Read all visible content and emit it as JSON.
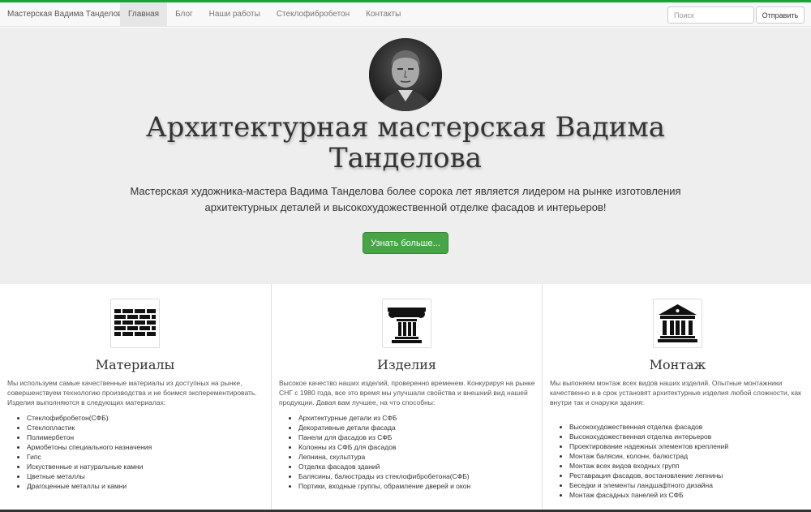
{
  "header": {
    "brand": "Мастерская Вадима Танделова",
    "nav": [
      {
        "label": "Главная"
      },
      {
        "label": "Блог"
      },
      {
        "label": "Наши работы"
      },
      {
        "label": "Стеклофибробетон"
      },
      {
        "label": "Контакты"
      }
    ],
    "search_placeholder": "Поиск",
    "send_label": "Отправить"
  },
  "hero": {
    "title": "Архитектурная мастерская Вадима Танделова",
    "text": "Мастерская художника-мастера Вадима Танделова более сорока лет является лидером на рынке изготовления архитектурных деталей и высокохудожественной отделке фасадов и интерьеров!",
    "button_label": "Узнать больше..."
  },
  "columns": [
    {
      "title": "Материалы",
      "icon": "brick-wall-icon",
      "text": "Мы используем самые качественные материалы из доступных на рынке, совершенствуем технологию производства и не боимся эксперементировать. Изделия выполняются в следующих материалах:",
      "items": [
        "Стеклофибробетон(СФБ)",
        "Стеклопластик",
        "Полимербетон",
        "Армобетоны специального назначения",
        "Гипс",
        "Искуственные и натуральные камни",
        "Цветные металлы",
        "Драгоценные металлы и камни"
      ]
    },
    {
      "title": "Изделия",
      "icon": "column-capital-icon",
      "text": "Высокое качество наших изделий, проверенно временем. Конкурируя на рынке СНГ с 1980 года, все это время мы улучшали свойства и внешний вид нашей продукции. Давая вам лучшее, на что способны:",
      "items": [
        "Архитектурные детали из СФБ",
        "Декоративные детали фасада",
        "Панели для фасадов из СФБ",
        "Колонны из СФБ для фасадов",
        "Лепнина, скульптура",
        "Отделка фасадов зданий",
        "Балясины, балюстрады из стеклофибробетона(СФБ)",
        "Портики, входные группы, обрамление дверей и окон"
      ]
    },
    {
      "title": "Монтаж",
      "icon": "classical-building-icon",
      "text": "Мы выпоняем монтаж всех видов наших изделий. Опытные монтажники качественно и в срок установят архитектурные изделия любой сложности, как внутри так и снаружи здания:",
      "items": [
        "Высокохудожественная отделка фасадов",
        "Высокохудожественная отделка интерьеров",
        "Проектирование надежных элементов креплений",
        "Монтаж балясин, колонн, балюстрад",
        "Монтаж всех видов входных групп",
        "Реставрация фасадов, востановление лепнины",
        "Беседки и элементы ландшафтного дизайна",
        "Монтаж фасадных панелей из СФБ"
      ]
    }
  ]
}
